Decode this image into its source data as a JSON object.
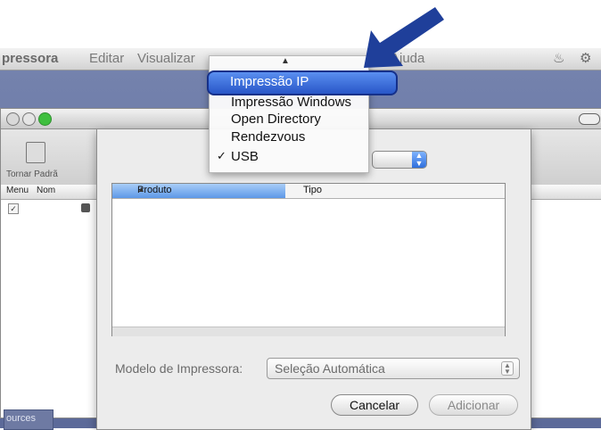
{
  "menubar": {
    "app": "pressora",
    "edit": "Editar",
    "view": "Visualizar",
    "help": "Ajuda"
  },
  "printer_list": {
    "toolbar_label": "Tornar Padrã",
    "col_menu": "Menu",
    "col_name": "Nom"
  },
  "bottom_tab": "ources",
  "connection_menu": {
    "selected": "Impressão IP",
    "items": [
      "Impressão Windows",
      "Open Directory",
      "Rendezvous",
      "USB"
    ],
    "checked": "USB"
  },
  "table": {
    "col_product": "Produto",
    "col_type": "Tipo",
    "rows": []
  },
  "model": {
    "label": "Modelo de Impressora:",
    "value": "Seleção Automática"
  },
  "buttons": {
    "cancel": "Cancelar",
    "add": "Adicionar"
  },
  "colors": {
    "accent": "#2856c8",
    "arrow": "#1f3f9a",
    "desktop": "#6a78a6"
  }
}
